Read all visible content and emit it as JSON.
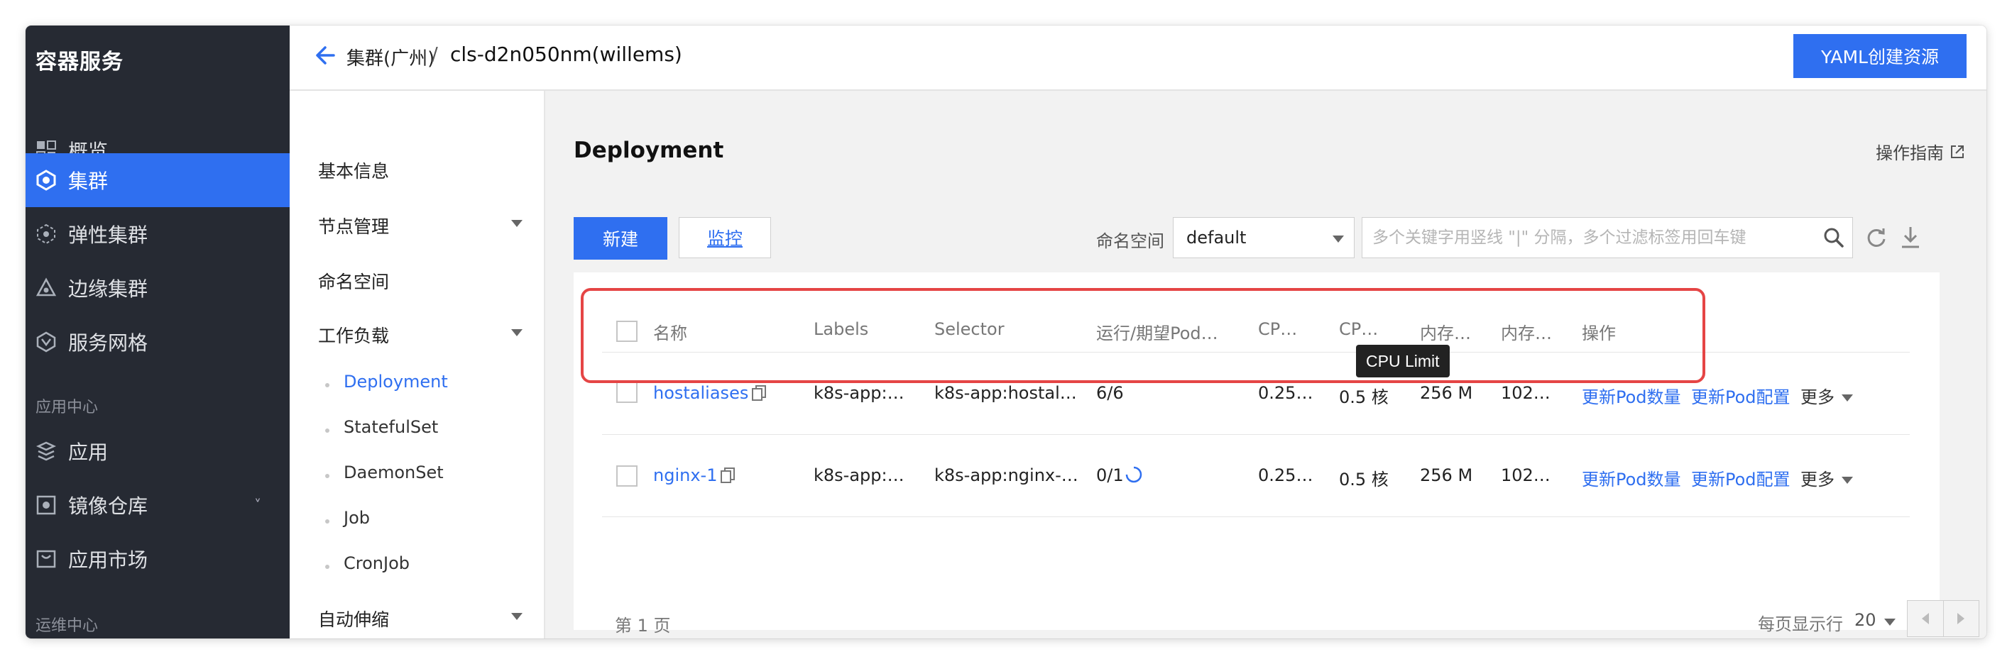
{
  "sidebar": {
    "brand": "容器服务",
    "items": [
      {
        "label": "概览",
        "icon": "dashboard-grid-icon"
      },
      {
        "label": "集群",
        "icon": "cluster-icon",
        "active": true
      },
      {
        "label": "弹性集群",
        "icon": "elastic-cluster-icon"
      },
      {
        "label": "边缘集群",
        "icon": "edge-cluster-icon"
      },
      {
        "label": "服务网格",
        "icon": "service-mesh-icon"
      }
    ],
    "section_app": "应用中心",
    "app_items": [
      {
        "label": "应用",
        "icon": "app-icon"
      },
      {
        "label": "镜像仓库",
        "icon": "image-repo-icon",
        "chevron": "˅"
      },
      {
        "label": "应用市场",
        "icon": "app-market-icon"
      }
    ],
    "section_ops": "运维中心"
  },
  "header": {
    "breadcrumb_parent": "集群(广州)",
    "breadcrumb_separator": "/",
    "breadcrumb_current": "cls-d2n050nm(willems)",
    "yaml_button": "YAML创建资源"
  },
  "submenu": {
    "basic_info": "基本信息",
    "node_mgmt": "节点管理",
    "namespace": "命名空间",
    "workload": "工作负载",
    "workload_children": [
      "Deployment",
      "StatefulSet",
      "DaemonSet",
      "Job",
      "CronJob"
    ],
    "autoscale": "自动伸缩"
  },
  "main": {
    "title": "Deployment",
    "guide": "操作指南",
    "new_button": "新建",
    "monitor_button": "监控",
    "namespace_label": "命名空间",
    "namespace_value": "default",
    "search_placeholder": "多个关键字用竖线 \"|\" 分隔，多个过滤标签用回车键"
  },
  "table": {
    "headers": [
      "名称",
      "Labels",
      "Selector",
      "运行/期望Pod…",
      "CP…",
      "CP…",
      "内存…",
      "内存…",
      "操作"
    ],
    "rows": [
      {
        "name": "hostaliases",
        "labels": "k8s-app:…",
        "selector": "k8s-app:hostal…",
        "pods": "6/6",
        "cpu_request": "0.25…",
        "cpu_limit": "0.5 核",
        "mem_request": "256 M",
        "mem_limit": "102…",
        "action1": "更新Pod数量",
        "action2": "更新Pod配置",
        "more": "更多"
      },
      {
        "name": "nginx-1",
        "labels": "k8s-app:…",
        "selector": "k8s-app:nginx-…",
        "pods": "0/1",
        "cpu_request": "0.25…",
        "cpu_limit": "0.5 核",
        "mem_request": "256 M",
        "mem_limit": "102…",
        "action1": "更新Pod数量",
        "action2": "更新Pod配置",
        "more": "更多"
      }
    ],
    "tooltip": "CPU Limit",
    "page_info": "第 1 页",
    "per_page_label": "每页显示行",
    "per_page_value": "20"
  },
  "colors": {
    "accent": "#2f6ff0",
    "sidebar_bg": "#262a33",
    "highlight": "#e54545"
  }
}
